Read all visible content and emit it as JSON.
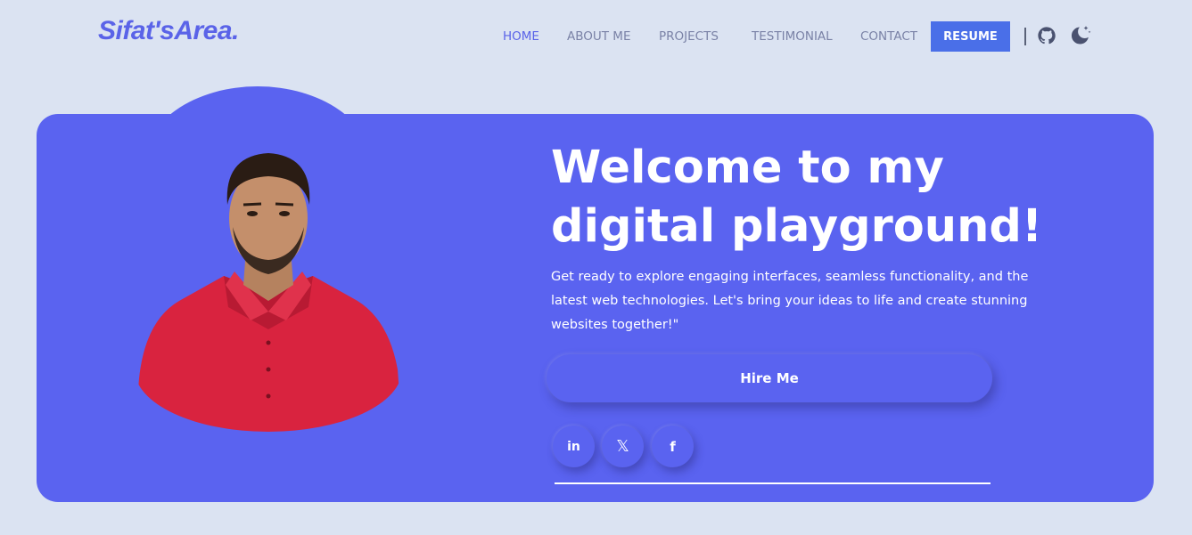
{
  "brand": {
    "logo_text": "Sifat'sArea."
  },
  "nav": {
    "items": [
      {
        "label": "HOME",
        "active": true
      },
      {
        "label": "ABOUT ME",
        "active": false
      },
      {
        "label": "PROJECTS",
        "active": false
      },
      {
        "label": "TESTIMONIAL",
        "active": false
      },
      {
        "label": "CONTACT",
        "active": false
      }
    ],
    "resume_label": "RESUME",
    "icons": [
      "github-icon",
      "dark-mode-moon-icon"
    ]
  },
  "hero": {
    "title_line1": "Welcome to my",
    "title_line2": "digital playground!",
    "description": "Get ready to explore engaging interfaces, seamless functionality, and the latest web technologies. Let's bring your ideas to life and create stunning websites together!\"",
    "hire_label": "Hire Me",
    "social": [
      {
        "label": "in",
        "icon": "linkedin-icon"
      },
      {
        "label": "𝕏",
        "icon": "x-twitter-icon"
      },
      {
        "label": "f",
        "icon": "facebook-icon"
      }
    ]
  },
  "colors": {
    "background": "#dbe3f2",
    "accent": "#5a63f0",
    "brand": "#5a63e8",
    "resume_button": "#4a6fe8",
    "nav_text": "#7a82a6"
  }
}
